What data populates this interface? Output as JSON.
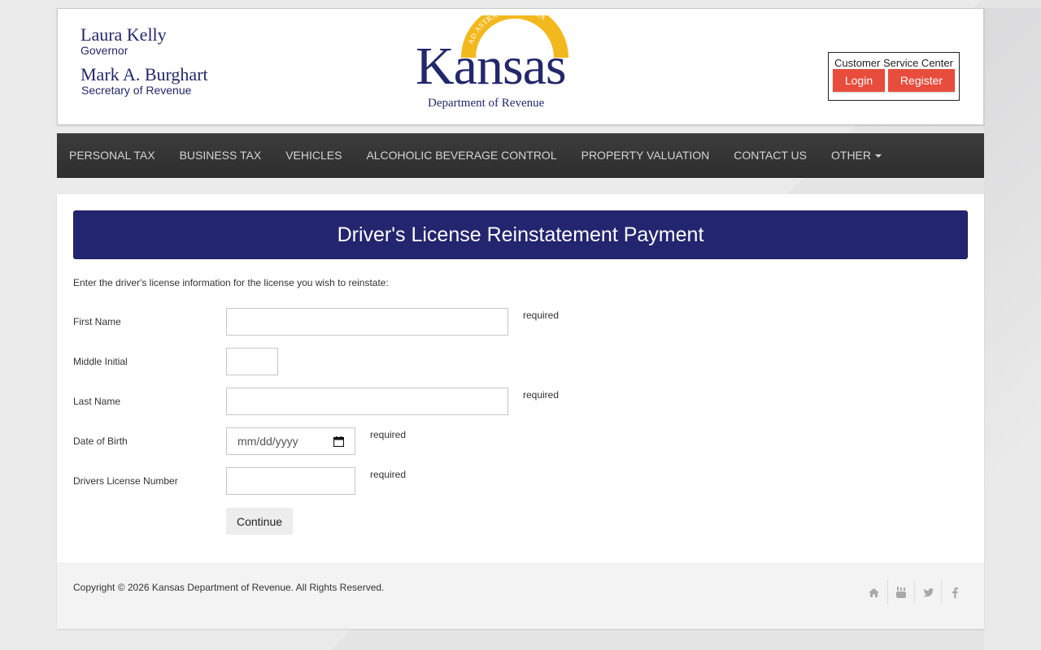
{
  "header": {
    "governor": {
      "name": "Laura Kelly",
      "title": "Governor"
    },
    "secretary": {
      "name": "Mark A. Burghart",
      "title": "Secretary of Revenue"
    },
    "logo": {
      "motto": "AD ASTRA PER ASPERA",
      "word": "Kansas",
      "department": "Department of Revenue"
    },
    "customer_service": {
      "title": "Customer Service Center",
      "login_label": "Login",
      "register_label": "Register"
    }
  },
  "nav": {
    "items": [
      {
        "label": "PERSONAL TAX"
      },
      {
        "label": "BUSINESS TAX"
      },
      {
        "label": "VEHICLES"
      },
      {
        "label": "ALCOHOLIC BEVERAGE CONTROL"
      },
      {
        "label": "PROPERTY VALUATION"
      },
      {
        "label": "CONTACT US"
      },
      {
        "label": "OTHER"
      }
    ]
  },
  "page": {
    "title": "Driver's License Reinstatement Payment",
    "intro": "Enter the driver's license information for the license you wish to reinstate:"
  },
  "form": {
    "first_name": {
      "label": "First Name",
      "value": "",
      "required": "required"
    },
    "middle_initial": {
      "label": "Middle Initial",
      "value": ""
    },
    "last_name": {
      "label": "Last Name",
      "value": "",
      "required": "required"
    },
    "dob": {
      "label": "Date of Birth",
      "placeholder": "mm/dd/yyyy",
      "required": "required"
    },
    "license_number": {
      "label": "Drivers License Number",
      "value": "",
      "required": "required"
    },
    "continue_label": "Continue"
  },
  "footer": {
    "copyright": "Copyright © 2026 Kansas Department of Revenue. All Rights Reserved.",
    "social_icons": [
      "home-icon",
      "youtube-icon",
      "twitter-icon",
      "facebook-icon"
    ]
  },
  "colors": {
    "brand_navy": "#23256f",
    "accent_red": "#e74c3c",
    "nav_bg": "#333333",
    "logo_gold": "#f2b81d"
  }
}
